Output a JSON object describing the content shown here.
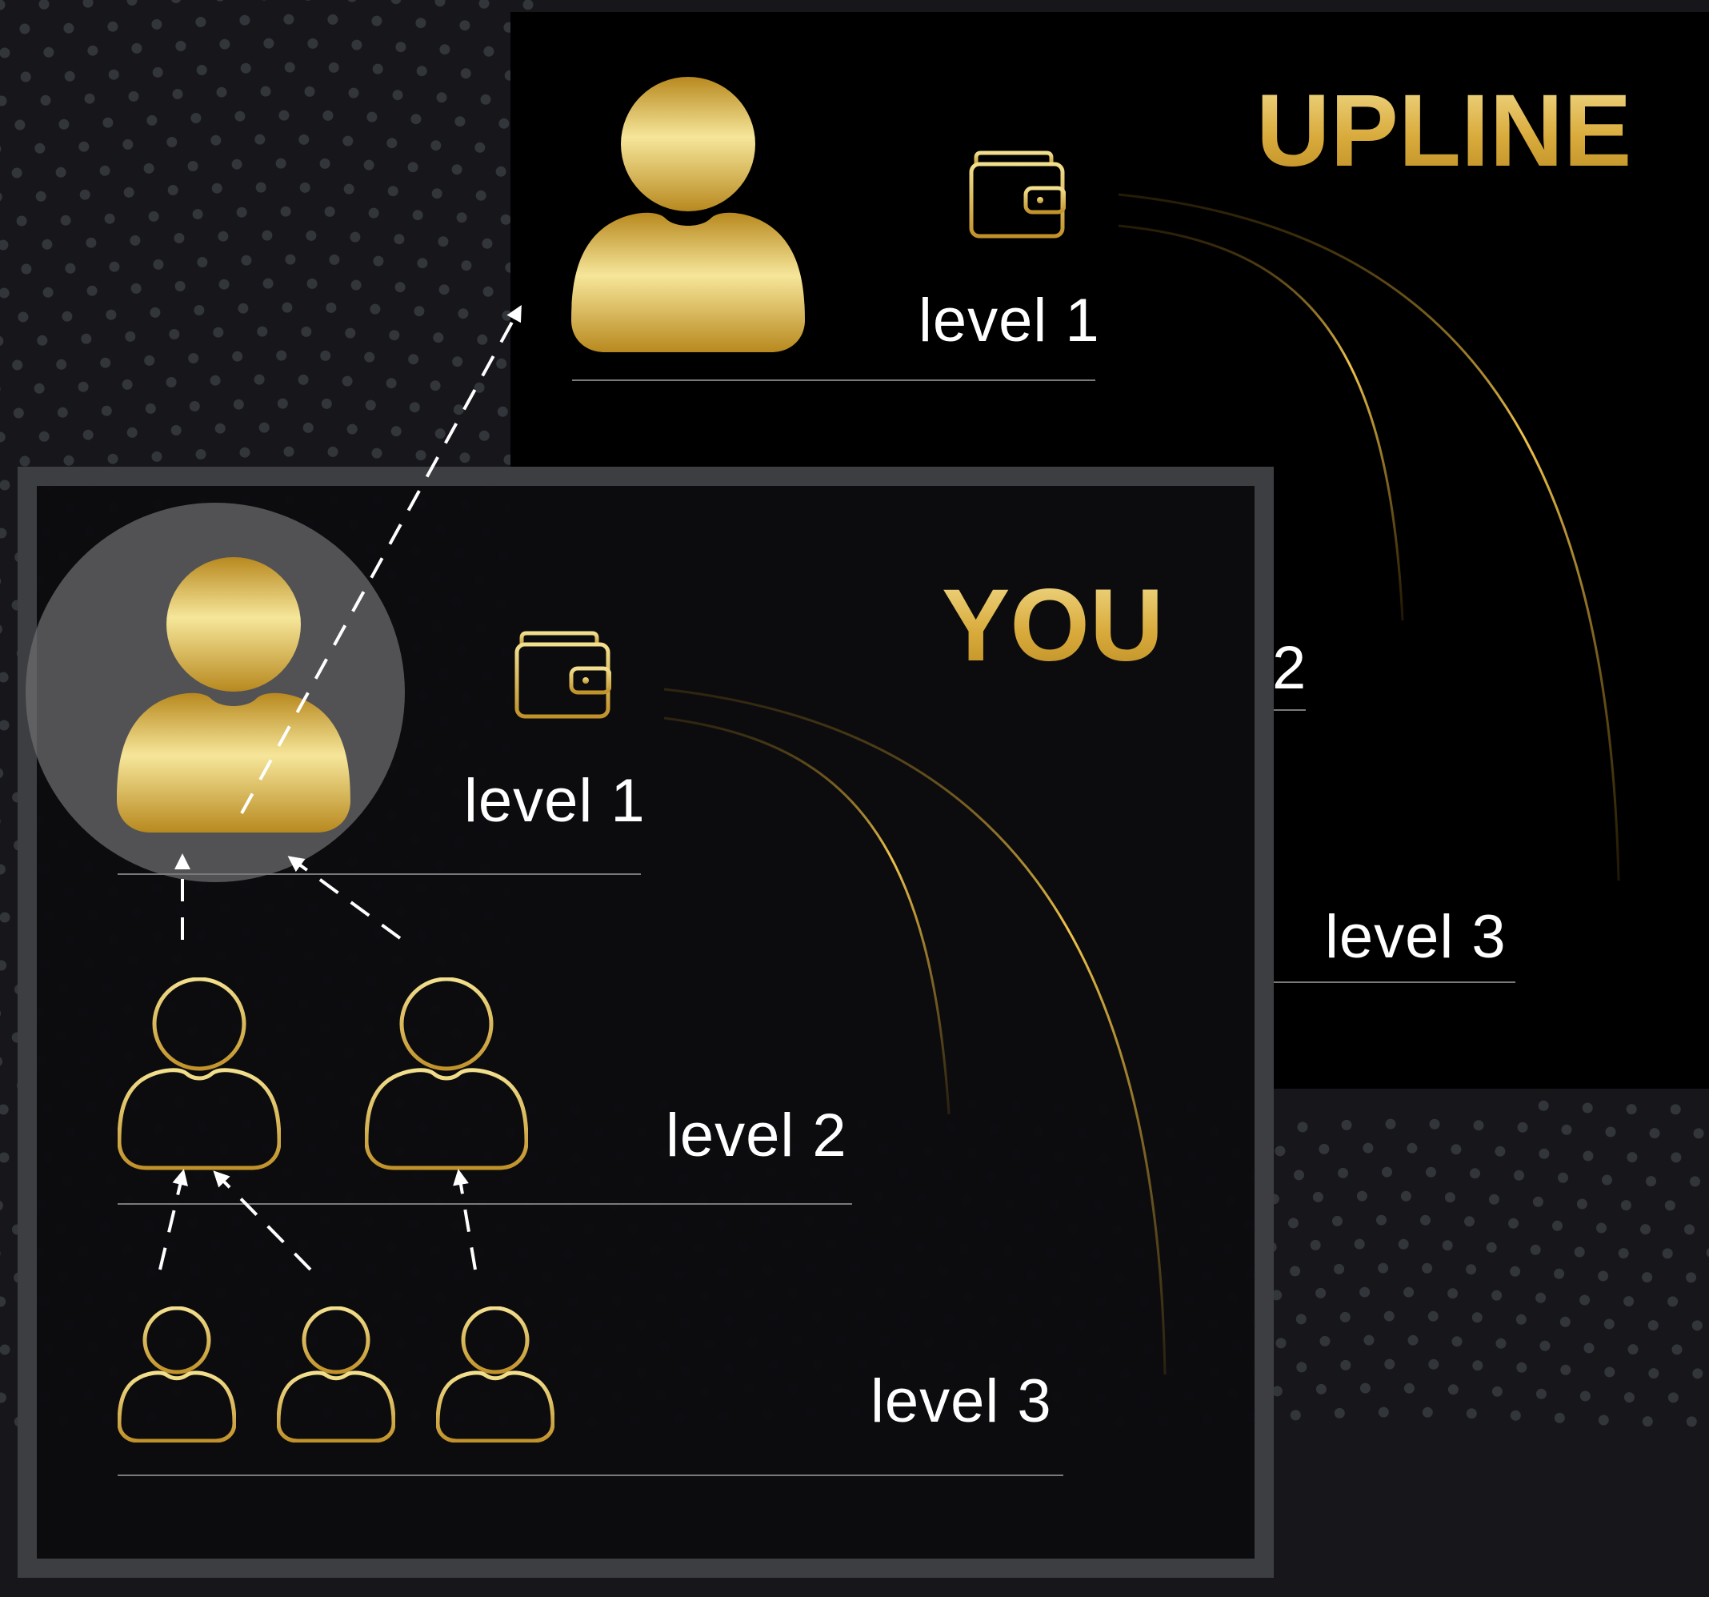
{
  "upline": {
    "title": "UPLINE",
    "level_1": "level 1",
    "level_2_suffix": "2",
    "level_3": "level 3"
  },
  "you": {
    "title": "YOU",
    "level_1": "level 1",
    "level_2": "level 2",
    "level_3": "level 3"
  },
  "icons": {
    "member_solid": "user-solid-icon",
    "member_outline": "user-outline-icon",
    "wallet": "wallet-icon",
    "arrow": "dashed-arrow"
  },
  "colors": {
    "gold_light": "#f3e08e",
    "gold_dark": "#b8891f",
    "panel_black": "#000000",
    "frame_gray": "#3d3e42",
    "text_white": "#ffffff"
  }
}
